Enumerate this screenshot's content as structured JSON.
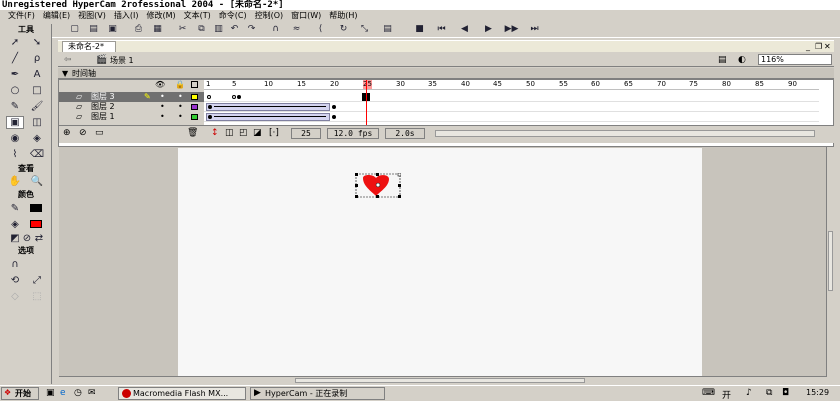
{
  "title": "Unregistered HyperCam 2rofessional 2004 - [未命名-2*]",
  "menu": [
    "文件(F)",
    "编辑(E)",
    "视图(V)",
    "插入(I)",
    "修改(M)",
    "文本(T)",
    "命令(C)",
    "控制(O)",
    "窗口(W)",
    "帮助(H)"
  ],
  "tools_panel": {
    "title": "工具",
    "view_label": "查看",
    "colors_label": "颜色",
    "options_label": "选项",
    "stroke_color": "#000000",
    "fill_color": "#ff0000"
  },
  "document": {
    "tab": "未命名-2*",
    "scene": "场景 1",
    "zoom": "116%"
  },
  "timeline": {
    "title": "时间轴",
    "layers": [
      "图层 3",
      "图层 2",
      "图层 1"
    ],
    "ruler": [
      "1",
      "5",
      "10",
      "15",
      "20",
      "25",
      "30",
      "35",
      "40",
      "45",
      "50",
      "55",
      "60",
      "65",
      "70",
      "75",
      "80",
      "85",
      "90"
    ],
    "current_frame": "25",
    "fps": "12.0 fps",
    "time": "2.0s"
  },
  "taskbar": {
    "start": "开始",
    "tasks": [
      "Macromedia Flash MX...",
      "HyperCam - 正在录制"
    ],
    "clock": "15:29"
  }
}
